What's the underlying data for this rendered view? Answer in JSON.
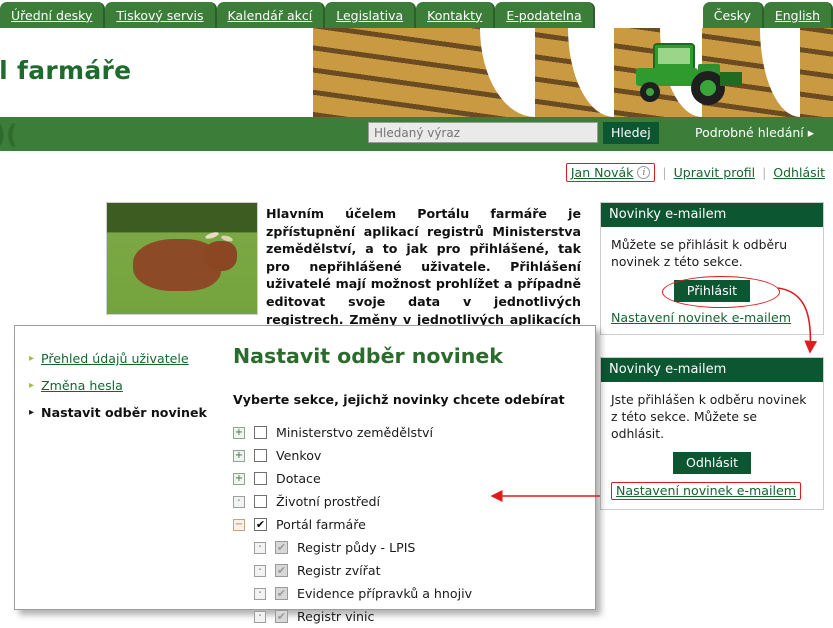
{
  "nav": {
    "tabs": [
      {
        "label": "Úřední desky",
        "link": true
      },
      {
        "label": "Tiskový servis",
        "link": true
      },
      {
        "label": "Kalendář akcí",
        "link": true
      },
      {
        "label": "Legislativa",
        "link": true
      },
      {
        "label": "Kontakty",
        "link": true
      },
      {
        "label": "E-podatelna",
        "link": true
      }
    ],
    "lang_cs": "Česky",
    "lang_en": "English"
  },
  "banner": {
    "title": "ál farmáře"
  },
  "search": {
    "placeholder": "Hledaný výraz",
    "value": "",
    "button": "Hledej",
    "advanced": "Podrobné hledání ▸"
  },
  "user": {
    "name": "Jan Novák",
    "info_icon": "info-icon",
    "edit_profile": "Upravit profil",
    "logout": "Odhlásit"
  },
  "main": {
    "paragraph": "Hlavním účelem Portálu farmáře je zpřístupnění aplikací registrů Ministerstva zemědělství, a to jak pro přihlášené, tak pro nepřihlášené uživatele. Přihlášení uživatelé mají možnost prohlížet a případně editovat svoje data v jednotlivých registrech. Změny v jednotlivých aplikacích jsou prezentovány formou novinek."
  },
  "newsbox1": {
    "header": "Novinky e-mailem",
    "body": "Můžete se přihlásit k odběru novinek z této sekce.",
    "button": "Přihlásit",
    "link": "Nastavení novinek e-mailem"
  },
  "newsbox2": {
    "header": "Novinky e-mailem",
    "body": "Jste přihlášen k odběru novinek z této sekce. Můžete se odhlásit.",
    "button": "Odhlásit",
    "link": "Nastavení novinek e-mailem"
  },
  "panel": {
    "sidebar": [
      {
        "label": "Přehled údajů uživatele",
        "active": false
      },
      {
        "label": "Změna hesla",
        "active": false
      },
      {
        "label": "Nastavit odběr novinek",
        "active": true
      }
    ],
    "title": "Nastavit odběr novinek",
    "subtitle": "Vyberte sekce, jejichž novinky chcete odebírat",
    "tree": [
      {
        "label": "Ministerstvo zemědělství",
        "toggle": "plus",
        "checked": false,
        "child": false,
        "disabled": false
      },
      {
        "label": "Venkov",
        "toggle": "plus",
        "checked": false,
        "child": false,
        "disabled": false
      },
      {
        "label": "Dotace",
        "toggle": "plus",
        "checked": false,
        "child": false,
        "disabled": false
      },
      {
        "label": "Životní prostředí",
        "toggle": "dot",
        "checked": false,
        "child": false,
        "disabled": false
      },
      {
        "label": "Portál farmáře",
        "toggle": "minus",
        "checked": true,
        "child": false,
        "disabled": false
      },
      {
        "label": "Registr půdy - LPIS",
        "toggle": "dot",
        "checked": true,
        "child": true,
        "disabled": true
      },
      {
        "label": "Registr zvířat",
        "toggle": "dot",
        "checked": true,
        "child": true,
        "disabled": true
      },
      {
        "label": "Evidence přípravků a hnojiv",
        "toggle": "dot",
        "checked": true,
        "child": true,
        "disabled": true
      },
      {
        "label": "Registr vinic",
        "toggle": "dot",
        "checked": true,
        "child": true,
        "disabled": true
      }
    ]
  },
  "annotations": {
    "accent_red": "#e01b1b",
    "ellipse_target": "Přihlásit",
    "arrow1": "curved arrow from Přihlásit ellipse to second Novinky e-mailem box",
    "arrow2": "horizontal arrow from Nastavení novinek e-mailem link to panel"
  },
  "colors": {
    "nav_green": "#3c7d3a",
    "header_green": "#0d5632",
    "title_green": "#2b6b2c",
    "link_green": "#14662f"
  },
  "glyphs": {
    "plus": "+",
    "minus": "−",
    "dot": "·",
    "check": "✔",
    "arrow_bullet": "▸"
  }
}
